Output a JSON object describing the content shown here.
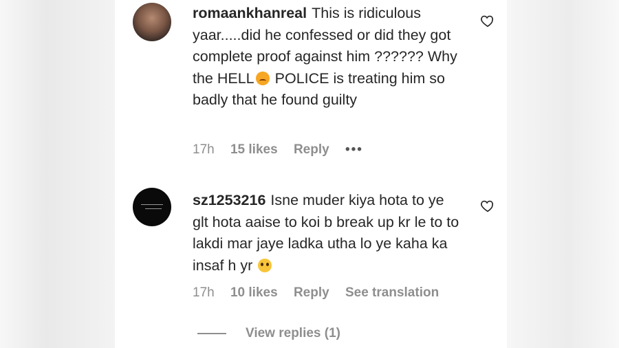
{
  "comments": [
    {
      "username": "romaankhanreal",
      "text_before_emoji": "This is ridiculous yaar.....did he confessed or did they got complete proof against him ?????? Why the HELL",
      "emoji": "angry-face",
      "text_after_emoji": " POLICE is treating him so badly that he found guilty",
      "time": "17h",
      "likes": "15 likes",
      "reply_label": "Reply",
      "more_label": "•••"
    },
    {
      "username": "sz1253216",
      "text_before_emoji": "Isne muder kiya hota to ye glt hota aaise to koi b break up kr le to to lakdi mar jaye ladka utha lo ye kaha ka insaf h yr",
      "emoji": "pleading-face",
      "text_after_emoji": "",
      "time": "17h",
      "likes": "10 likes",
      "reply_label": "Reply",
      "translation_label": "See translation"
    }
  ],
  "view_replies": "View replies (1)",
  "colors": {
    "text": "#262626",
    "meta": "#8e8e8e",
    "background": "#ffffff"
  }
}
